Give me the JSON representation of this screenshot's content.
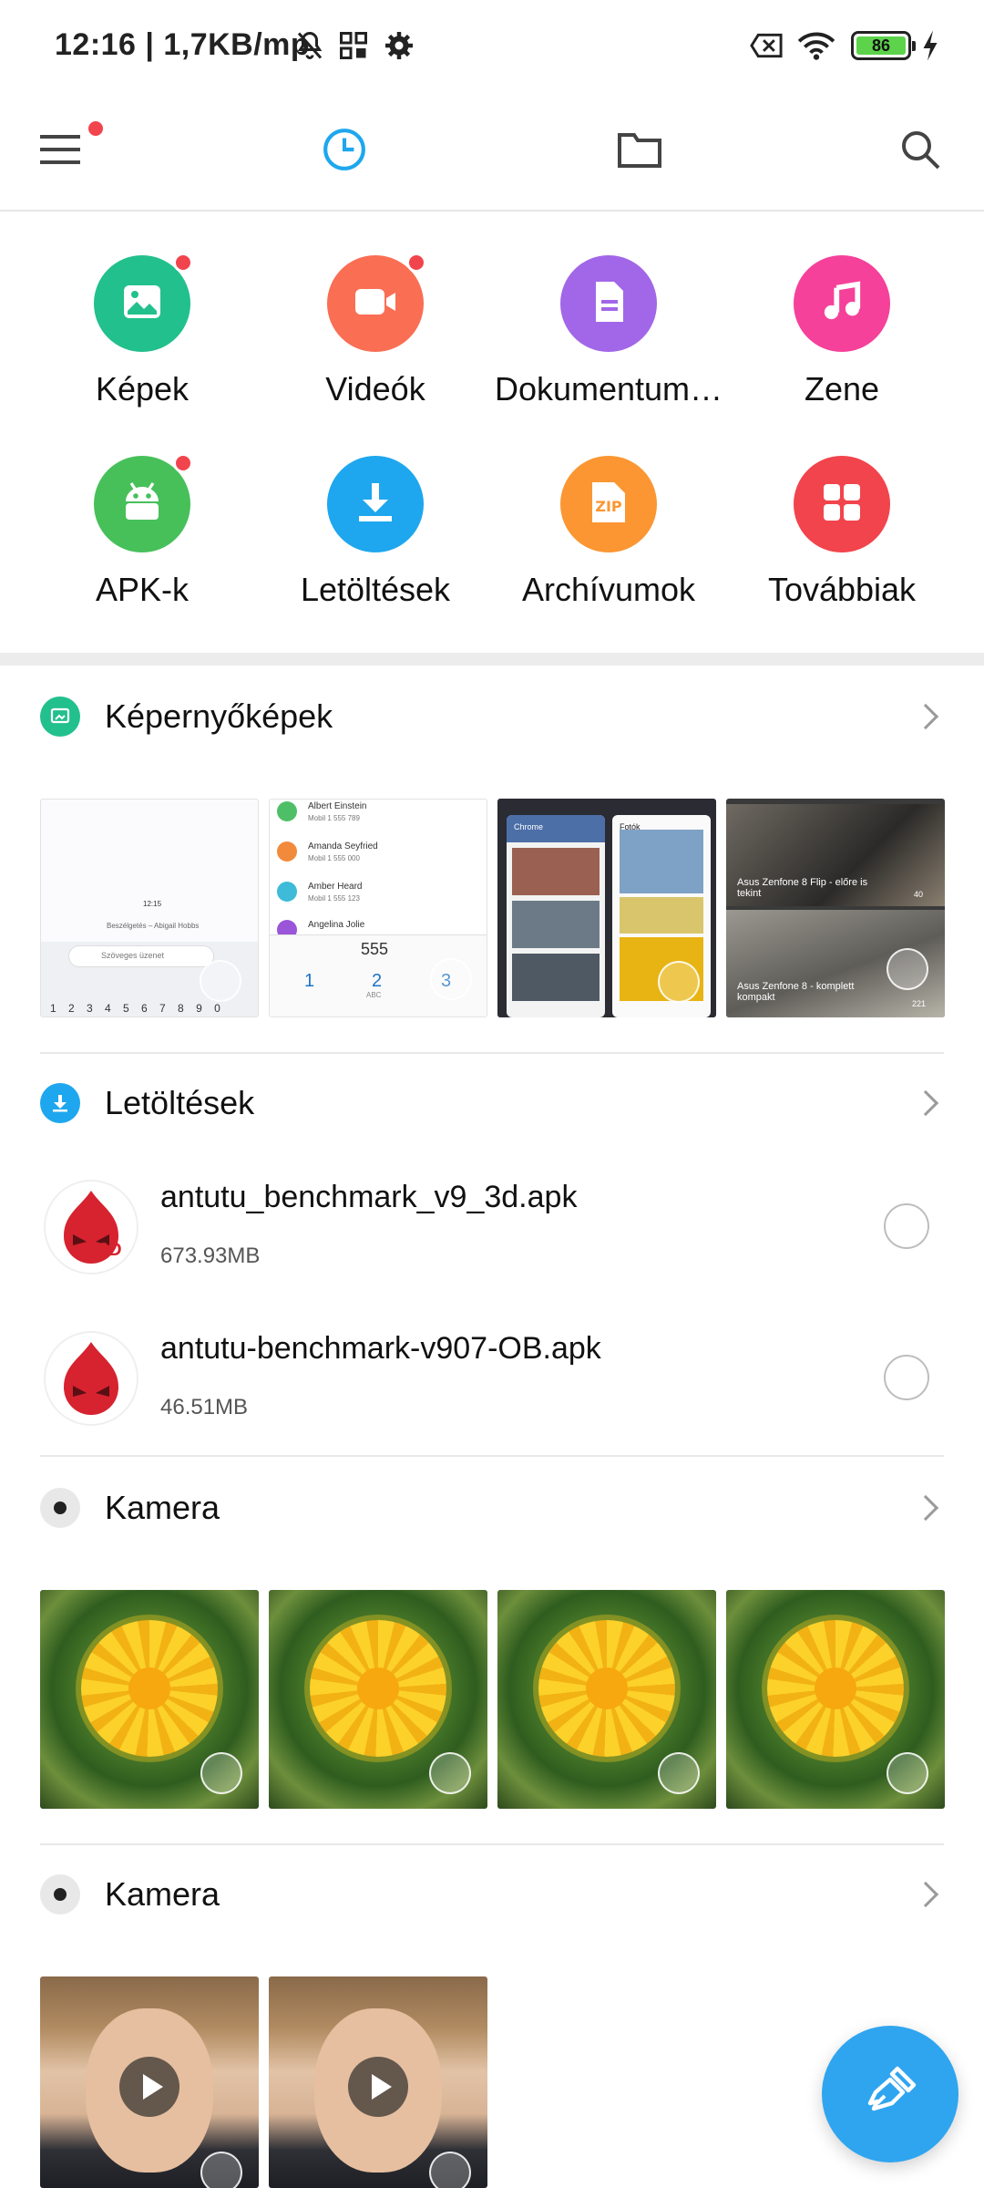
{
  "status_bar": {
    "time": "12:16 | 1,7KB/mp",
    "battery": "86"
  },
  "top_nav": {
    "menu": "hamburger-menu-icon",
    "recent": "clock-icon",
    "files": "folder-icon",
    "search": "search-icon"
  },
  "categories": [
    {
      "label": "Képek",
      "color": "#22c08c",
      "icon": "image-icon",
      "badge": true
    },
    {
      "label": "Videók",
      "color": "#fa6e54",
      "icon": "video-icon",
      "badge": true
    },
    {
      "label": "Dokumentum…",
      "color": "#a267e8",
      "icon": "document-icon",
      "badge": false
    },
    {
      "label": "Zene",
      "color": "#f5419a",
      "icon": "music-icon",
      "badge": false
    },
    {
      "label": "APK-k",
      "color": "#47c05a",
      "icon": "android-icon",
      "badge": true
    },
    {
      "label": "Letöltések",
      "color": "#1ea7ee",
      "icon": "download-icon",
      "badge": false
    },
    {
      "label": "Archívumok",
      "color": "#fb9632",
      "icon": "zip-icon",
      "badge": false
    },
    {
      "label": "Továbbiak",
      "color": "#f2444c",
      "icon": "grid-icon",
      "badge": false
    }
  ],
  "sections": {
    "screenshots": {
      "title": "Képernyőképek",
      "thumbs": {
        "shot1": {
          "time": "12:15",
          "contact": "Beszélgetés – Abigail Hobbs",
          "input": "Szöveges üzenet",
          "keys": "1 2 3 4 5 6 7 8 9 0"
        },
        "shot2": {
          "contacts": [
            {
              "name": "Albert Einstein",
              "detail": "Mobil 1 555 789"
            },
            {
              "name": "Amanda Seyfried",
              "detail": "Mobil 1 555 000"
            },
            {
              "name": "Amber Heard",
              "detail": "Mobil 1 555 123"
            },
            {
              "name": "Angelina Jolie",
              "detail": ""
            }
          ],
          "dial": "555",
          "keys": [
            "1",
            "2",
            "3"
          ],
          "sub": [
            "",
            "ABC",
            "DEF"
          ]
        },
        "shot3": {
          "app1": "Chrome",
          "app2": "Fotók"
        },
        "shot4": {
          "cap1": "Asus Zenfone 8 Flip - előre is tekint",
          "count1": "40",
          "cap2": "Asus Zenfone 8 - komplett kompakt",
          "count2": "221"
        }
      }
    },
    "downloads": {
      "title": "Letöltések",
      "items": [
        {
          "name": "antutu_benchmark_v9_3d.apk",
          "size": "673.93MB",
          "badge": "3D"
        },
        {
          "name": "antutu-benchmark-v907-OB.apk",
          "size": "46.51MB",
          "badge": ""
        }
      ]
    },
    "camera1": {
      "title": "Kamera"
    },
    "camera2": {
      "title": "Kamera"
    }
  },
  "fab": {
    "icon": "broom-clean-icon"
  }
}
